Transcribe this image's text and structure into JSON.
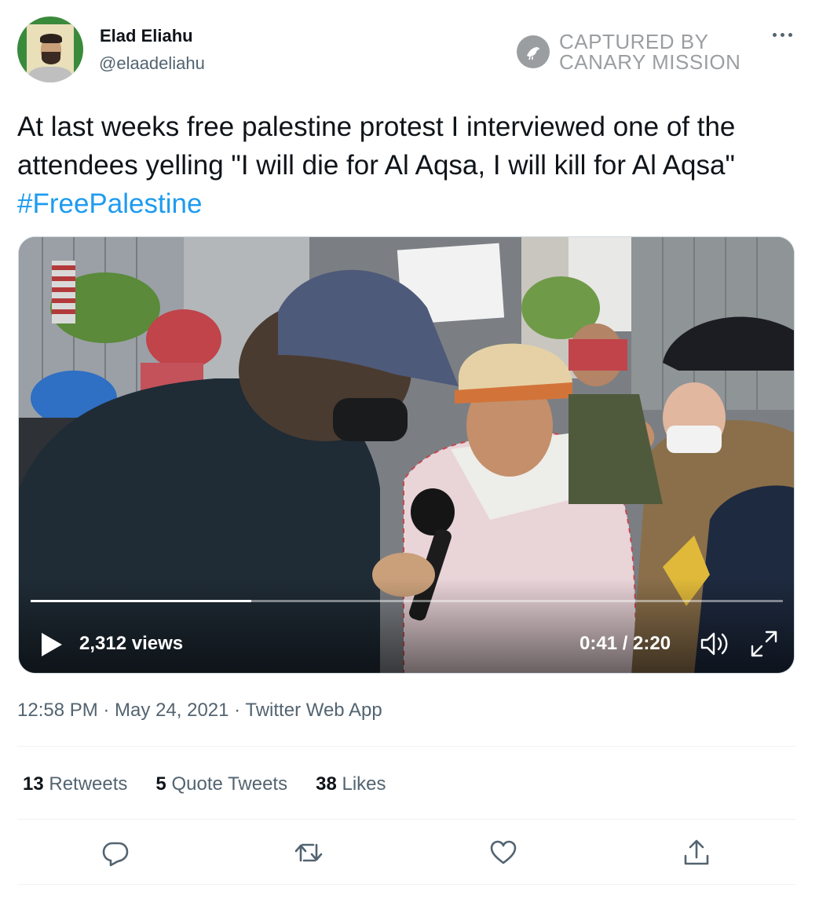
{
  "user": {
    "name": "Elad Eliahu",
    "handle": "@elaadeliahu"
  },
  "watermark": {
    "line1": "CAPTURED BY",
    "line2": "CANARY MISSION"
  },
  "tweet": {
    "text": "At last weeks free palestine protest I interviewed one of the attendees yelling \"I will die for Al Aqsa, I will kill for Al Aqsa\" ",
    "hashtag": "#FreePalestine"
  },
  "video": {
    "views": "2,312 views",
    "time": "0:41 / 2:20",
    "progress": 0.293
  },
  "meta": {
    "timestamp": "12:58 PM · May 24, 2021 · Twitter Web App"
  },
  "stats": {
    "retweets_count": "13",
    "retweets_label": "Retweets",
    "quotes_count": "5",
    "quotes_label": "Quote Tweets",
    "likes_count": "38",
    "likes_label": "Likes"
  },
  "icons": [
    "more-icon",
    "play-icon",
    "volume-icon",
    "fullscreen-icon",
    "reply-icon",
    "retweet-icon",
    "like-icon",
    "share-icon"
  ],
  "colors": {
    "link": "#1d9bf0",
    "text": "#0f1419",
    "secondary": "#536471"
  }
}
